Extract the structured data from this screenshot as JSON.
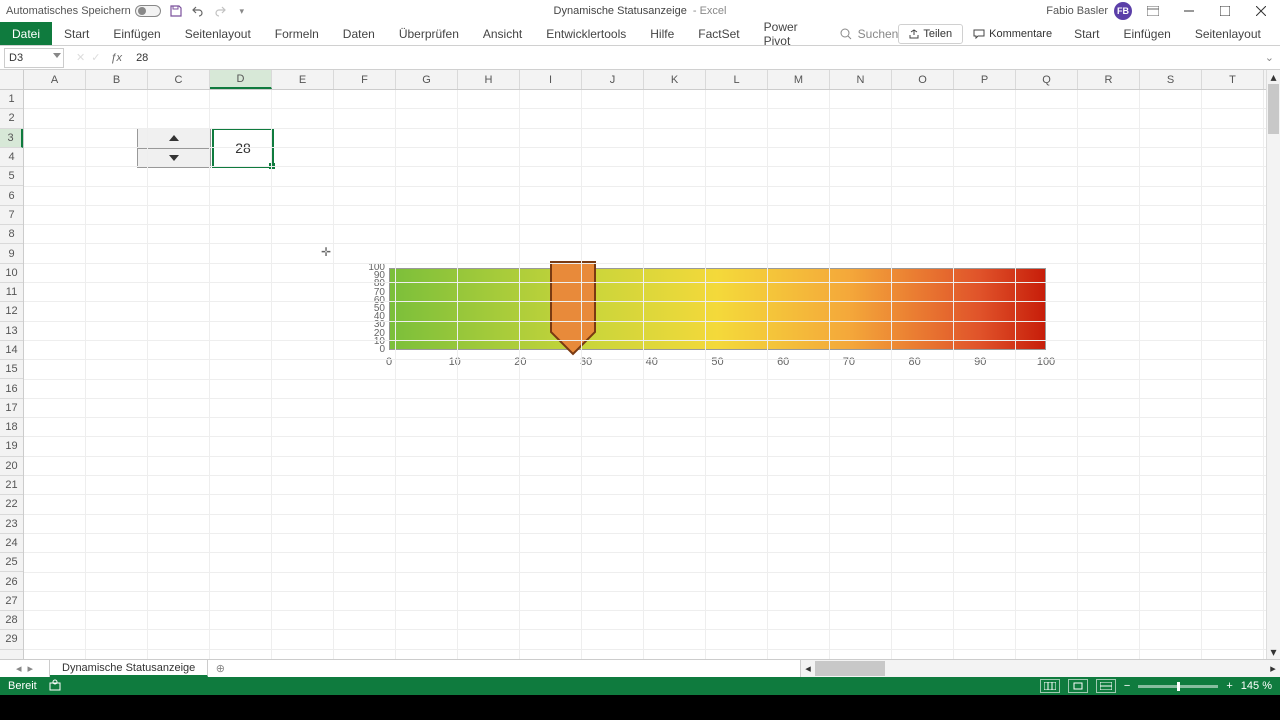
{
  "titlebar": {
    "autosave_label": "Automatisches Speichern",
    "doc_name": "Dynamische Statusanzeige",
    "app_name": "Excel",
    "user_name": "Fabio Basler",
    "user_initials": "FB"
  },
  "ribbon": {
    "file": "Datei",
    "tabs": [
      "Start",
      "Einfügen",
      "Seitenlayout",
      "Formeln",
      "Daten",
      "Überprüfen",
      "Ansicht",
      "Entwicklertools",
      "Hilfe",
      "FactSet",
      "Power Pivot"
    ],
    "search_placeholder": "Suchen",
    "share": "Teilen",
    "comments": "Kommentare"
  },
  "formula_bar": {
    "cell_ref": "D3",
    "formula": "28"
  },
  "grid": {
    "columns": [
      "A",
      "B",
      "C",
      "D",
      "E",
      "F",
      "G",
      "H",
      "I",
      "J",
      "K",
      "L",
      "M",
      "N",
      "O",
      "P",
      "Q",
      "R",
      "S",
      "T"
    ],
    "rows": [
      "1",
      "2",
      "3",
      "4",
      "5",
      "6",
      "7",
      "8",
      "9",
      "10",
      "11",
      "12",
      "13",
      "14",
      "15",
      "16",
      "17",
      "18",
      "19",
      "20",
      "21",
      "22",
      "23",
      "24",
      "25",
      "26",
      "27",
      "28",
      "29"
    ],
    "selected_col": "D",
    "selected_row": "3",
    "cell_value": "28"
  },
  "chart_data": {
    "type": "bar",
    "x_ticks": [
      0,
      10,
      20,
      30,
      40,
      50,
      60,
      70,
      80,
      90,
      100
    ],
    "y_ticks": [
      0,
      10,
      20,
      30,
      40,
      50,
      60,
      70,
      80,
      90,
      100
    ],
    "xlim": [
      0,
      100
    ],
    "ylim": [
      0,
      100
    ],
    "gradient_stops": [
      {
        "pos": 0,
        "color": "#7bbf3a"
      },
      {
        "pos": 30,
        "color": "#c9d53a"
      },
      {
        "pos": 50,
        "color": "#f4d93a"
      },
      {
        "pos": 70,
        "color": "#f4a83a"
      },
      {
        "pos": 90,
        "color": "#e0532a"
      },
      {
        "pos": 100,
        "color": "#c71e0a"
      }
    ],
    "marker_value": 28,
    "marker_color": "#e88a3a",
    "title": "",
    "xlabel": "",
    "ylabel": ""
  },
  "sheets": {
    "active": "Dynamische Statusanzeige"
  },
  "statusbar": {
    "ready": "Bereit",
    "zoom": "145 %"
  }
}
